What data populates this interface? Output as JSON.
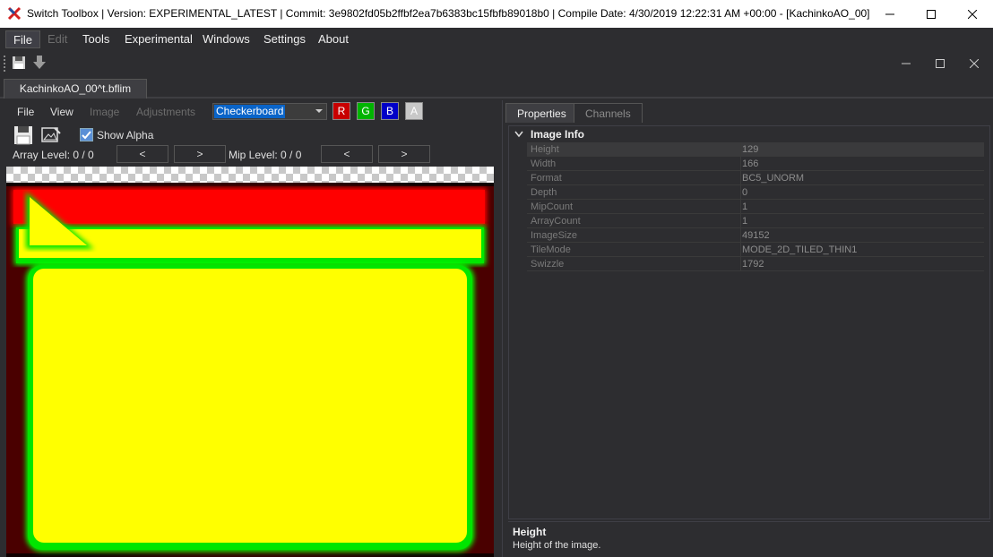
{
  "window": {
    "title": "Switch Toolbox | Version: EXPERIMENTAL_LATEST | Commit: 3e9802fd05b2ffbf2ea7b6383bc15fbfb89018b0 | Compile Date: 4/30/2019 12:22:31 AM +00:00 - [KachinkoAO_00]"
  },
  "menu": {
    "items": [
      "File",
      "Edit",
      "Tools",
      "Experimental",
      "Windows",
      "Settings",
      "About"
    ]
  },
  "document_tab": {
    "label": "KachinkoAO_00^t.bflim"
  },
  "image_editor": {
    "menu": [
      "File",
      "View",
      "Image",
      "Adjustments"
    ],
    "background_select": {
      "value": "Checkerboard"
    },
    "channels": [
      {
        "label": "R",
        "color": "#c80000"
      },
      {
        "label": "G",
        "color": "#00b400"
      },
      {
        "label": "B",
        "color": "#0000c8"
      },
      {
        "label": "A",
        "color": "#c8c8c8"
      }
    ],
    "show_alpha": {
      "label": "Show Alpha",
      "checked": true
    },
    "array_level": "Array Level: 0 / 0",
    "mip_level": "Mip Level: 0 / 0",
    "prev": "<",
    "next": ">"
  },
  "properties": {
    "tabs": [
      "Properties",
      "Channels"
    ],
    "category": "Image Info",
    "rows": [
      {
        "key": "Height",
        "value": "129"
      },
      {
        "key": "Width",
        "value": "166"
      },
      {
        "key": "Format",
        "value": "BC5_UNORM"
      },
      {
        "key": "Depth",
        "value": "0"
      },
      {
        "key": "MipCount",
        "value": "1"
      },
      {
        "key": "ArrayCount",
        "value": "1"
      },
      {
        "key": "ImageSize",
        "value": "49152"
      },
      {
        "key": "TileMode",
        "value": "MODE_2D_TILED_THIN1"
      },
      {
        "key": "Swizzle",
        "value": "1792"
      }
    ],
    "description": {
      "title": "Height",
      "text": "Height of the image."
    }
  },
  "colors": {
    "background": "#2d2d30",
    "texture_red": "#ff0000",
    "texture_yellow": "#ffff00",
    "texture_green": "#00ff00"
  }
}
